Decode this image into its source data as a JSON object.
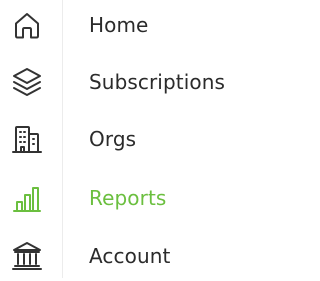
{
  "colors": {
    "text": "#2b2b2b",
    "icon": "#333333",
    "active": "#6bbf3f"
  },
  "sidebar": {
    "active_item": "Reports",
    "items": [
      {
        "label": "Home",
        "icon": "home-icon"
      },
      {
        "label": "Subscriptions",
        "icon": "layers-icon"
      },
      {
        "label": "Orgs",
        "icon": "buildings-icon"
      },
      {
        "label": "Reports",
        "icon": "bar-chart-icon"
      },
      {
        "label": "Account",
        "icon": "bank-icon"
      }
    ]
  }
}
